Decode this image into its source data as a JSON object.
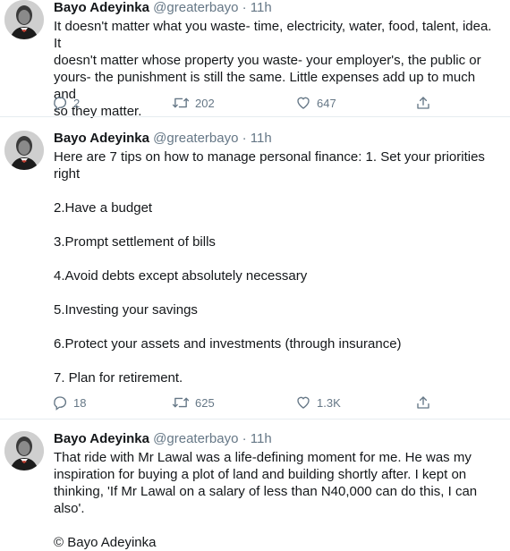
{
  "tweets": [
    {
      "name": "Bayo Adeyinka",
      "handle": "@greaterbayo",
      "sep": "·",
      "time": "11h",
      "lines": [
        "It doesn't matter what you waste- time, electricity, water, food, talent, idea. It",
        "doesn't matter whose property you waste- your employer's, the public or",
        "yours- the punishment is still the same. Little expenses add up to much and",
        "so they matter."
      ],
      "replies": "2",
      "retweets": "202",
      "likes": "647"
    },
    {
      "name": "Bayo Adeyinka",
      "handle": "@greaterbayo",
      "sep": "·",
      "time": "11h",
      "lines": [
        "Here are 7 tips on how to manage personal finance: 1. Set your priorities",
        "right",
        "2.Have a budget",
        "3.Prompt settlement of bills",
        "4.Avoid debts except absolutely necessary",
        "5.Investing your savings",
        "6.Protect your assets and investments (through insurance)",
        "7. Plan for retirement."
      ],
      "replies": "18",
      "retweets": "625",
      "likes": "1.3K"
    },
    {
      "name": "Bayo Adeyinka",
      "handle": "@greaterbayo",
      "sep": "·",
      "time": "11h",
      "lines": [
        "That ride with Mr Lawal was a life-defining moment for me. He was my",
        "inspiration for buying a plot of land and building shortly after. I kept on",
        "thinking, 'If Mr Lawal on a salary of less than N40,000 can do this, I can also'.",
        "© Bayo Adeyinka"
      ]
    }
  ],
  "icons": {
    "reply": "reply-icon",
    "retweet": "retweet-icon",
    "like": "heart-icon",
    "share": "share-icon"
  },
  "colors": {
    "text": "#14171a",
    "muted": "#657786",
    "divider": "#e6ecf0"
  }
}
